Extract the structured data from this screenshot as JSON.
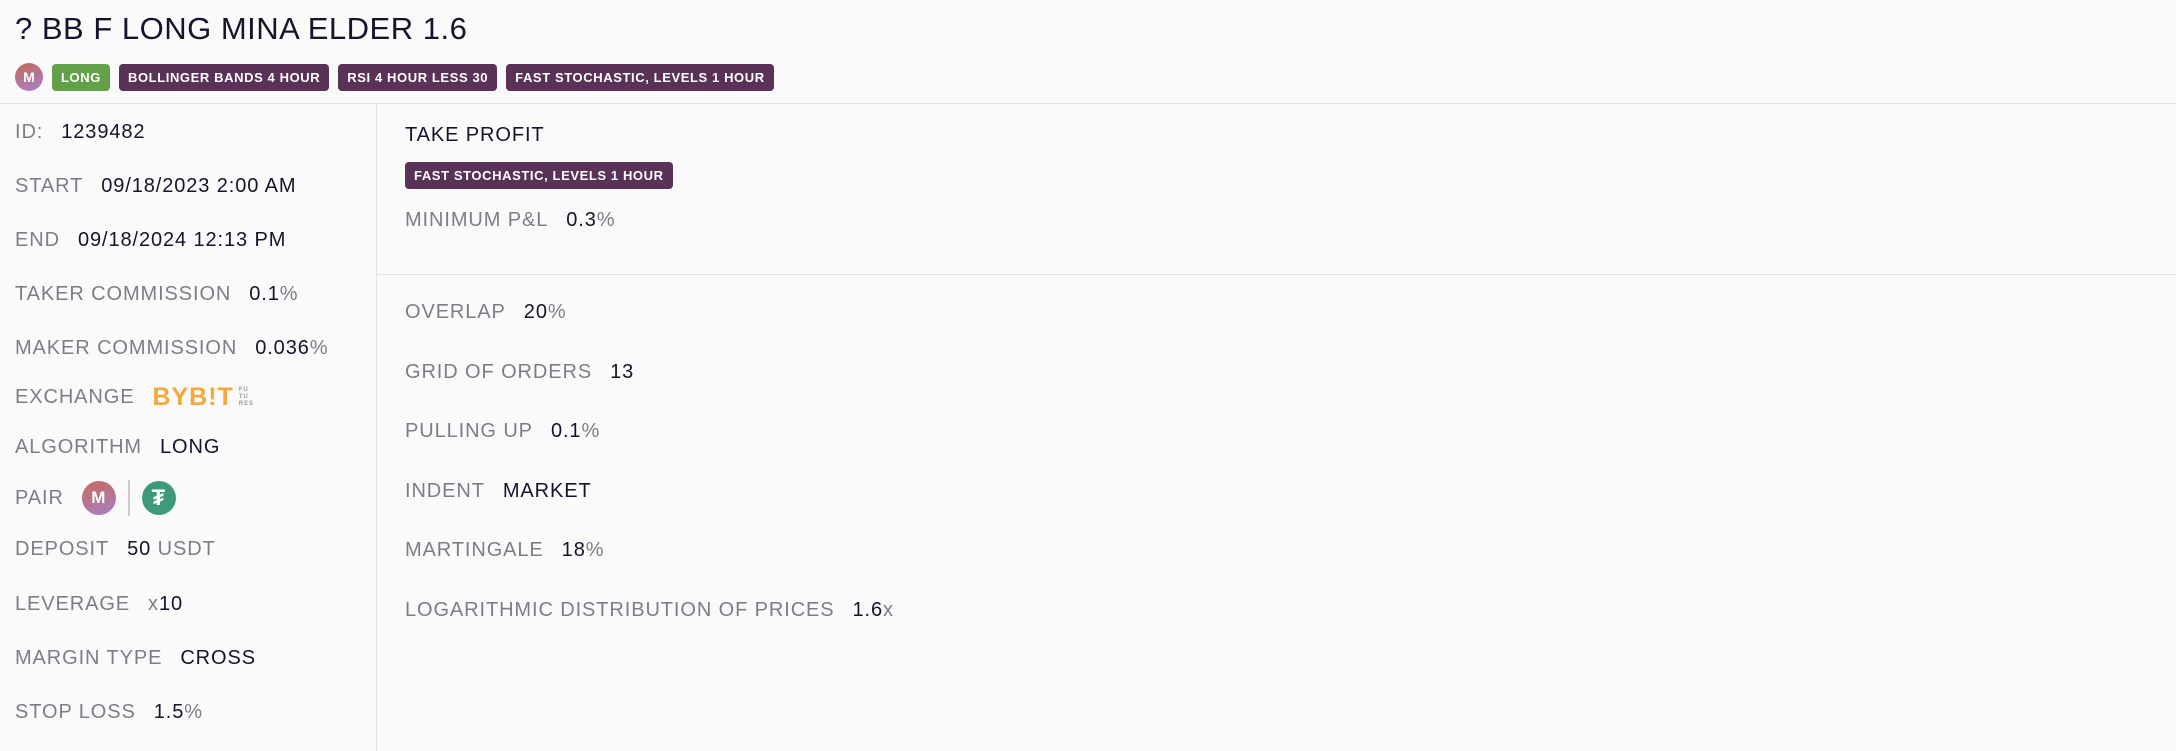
{
  "header": {
    "title": "? BB F LONG MINA ELDER 1.6",
    "coin_letter": "M",
    "tags": [
      "LONG",
      "BOLLINGER BANDS 4 HOUR",
      "RSI 4 HOUR LESS 30",
      "FAST STOCHASTIC, LEVELS 1 HOUR"
    ]
  },
  "details": {
    "id": {
      "label": "ID:",
      "value": "1239482"
    },
    "start": {
      "label": "START",
      "value": "09/18/2023 2:00 AM"
    },
    "end": {
      "label": "END",
      "value": "09/18/2024 12:13 PM"
    },
    "taker": {
      "label": "TAKER COMMISSION",
      "value": "0.1",
      "unit": "%"
    },
    "maker": {
      "label": "MAKER COMMISSION",
      "value": "0.036",
      "unit": "%"
    },
    "exchange": {
      "label": "EXCHANGE",
      "logo_text": "BYB!T",
      "logo_sub": [
        "FU",
        "TU",
        "RES"
      ]
    },
    "algorithm": {
      "label": "ALGORITHM",
      "value": "LONG"
    },
    "pair": {
      "label": "PAIR",
      "base_letter": "M",
      "quote_symbol": "₮"
    },
    "deposit": {
      "label": "DEPOSIT",
      "value": "50",
      "unit": "USDT"
    },
    "leverage": {
      "label": "LEVERAGE",
      "prefix": "x",
      "value": "10"
    },
    "margin_type": {
      "label": "MARGIN TYPE",
      "value": "CROSS"
    },
    "stop_loss": {
      "label": "STOP LOSS",
      "value": "1.5",
      "unit": "%"
    }
  },
  "take_profit": {
    "title": "TAKE PROFIT",
    "badge": "FAST STOCHASTIC, LEVELS 1 HOUR",
    "min_pnl": {
      "label": "MINIMUM P&L",
      "value": "0.3",
      "unit": "%"
    }
  },
  "settings": {
    "overlap": {
      "label": "OVERLAP",
      "value": "20",
      "unit": "%"
    },
    "grid": {
      "label": "GRID OF ORDERS",
      "value": "13"
    },
    "pulling": {
      "label": "PULLING UP",
      "value": "0.1",
      "unit": "%"
    },
    "indent": {
      "label": "INDENT",
      "value": "MARKET"
    },
    "martingale": {
      "label": "MARTINGALE",
      "value": "18",
      "unit": "%"
    },
    "log_dist": {
      "label": "LOGARITHMIC DISTRIBUTION OF PRICES",
      "value": "1.6",
      "unit": "x"
    }
  },
  "colors": {
    "long_badge": "#62a04a",
    "indicator_badge": "#5a3157",
    "bybit_logo": "#f2a93b",
    "usdt_coin": "#3f9a7b"
  },
  "icons": {
    "coin": "mina-coin-icon",
    "usdt": "tether-coin-icon",
    "exchange": "bybit-logo"
  }
}
